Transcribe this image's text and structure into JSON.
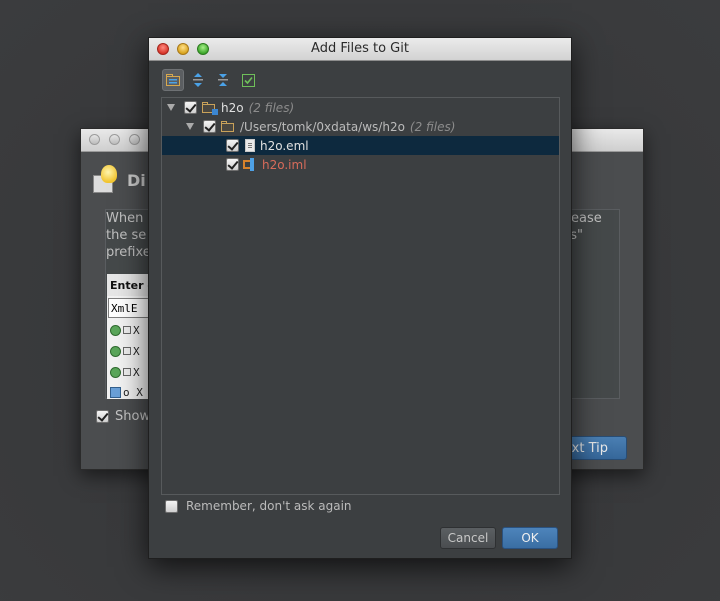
{
  "background_dialog": {
    "title_fragment": "Di",
    "text_lines": [
      "When",
      "the se",
      "prefixe",
      "ease",
      "ds\""
    ],
    "enter_label": "Enter c",
    "input_value": "XmlE",
    "rows": [
      "X",
      "X",
      "X",
      "o X"
    ],
    "show_label": "Show",
    "next_tip_label": "xt Tip"
  },
  "dialog": {
    "title": "Add Files to Git",
    "toolbar": [
      {
        "icon": "group-by-directory-icon",
        "active": true
      },
      {
        "icon": "expand-all-icon",
        "active": false
      },
      {
        "icon": "collapse-all-icon",
        "active": false
      },
      {
        "icon": "select-all-icon",
        "active": false
      }
    ],
    "tree": {
      "root": {
        "label": "h2o",
        "count": "(2 files)",
        "checked": true
      },
      "folder": {
        "label": "/Users/tomk/0xdata/ws/h2o",
        "count": "(2 files)",
        "checked": true
      },
      "files": [
        {
          "label": "h2o.eml",
          "checked": true,
          "selected": true,
          "color": "#e0e0e0"
        },
        {
          "label": "h2o.iml",
          "checked": true,
          "selected": false,
          "color": "#d86b5a"
        }
      ]
    },
    "remember_label": "Remember, don't ask again",
    "remember_checked": false,
    "cancel_label": "Cancel",
    "ok_label": "OK"
  }
}
